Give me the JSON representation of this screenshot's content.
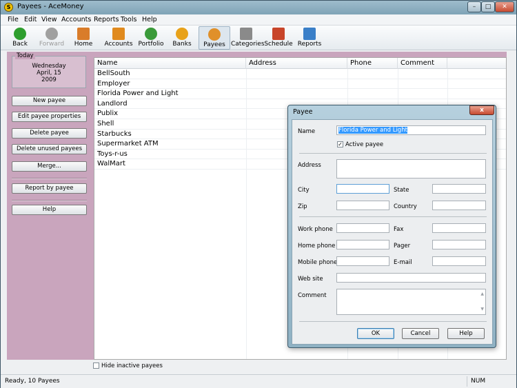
{
  "window": {
    "title": "Payees - AceMoney",
    "app_icon": "S"
  },
  "menu": [
    "File",
    "Edit",
    "View",
    "Accounts",
    "Reports",
    "Tools",
    "Help"
  ],
  "toolbar": [
    {
      "label": "Back",
      "icon": "back-arrow-icon",
      "color": "#2e9e2e"
    },
    {
      "label": "Forward",
      "icon": "forward-arrow-icon",
      "color": "#a0a0a0"
    },
    {
      "label": "Home",
      "icon": "home-icon",
      "color": "#d97c2a"
    },
    {
      "label": "Accounts",
      "icon": "accounts-icon",
      "color": "#e08a1e"
    },
    {
      "label": "Portfolio",
      "icon": "portfolio-icon",
      "color": "#3a9a3a"
    },
    {
      "label": "Banks",
      "icon": "banks-icon",
      "color": "#e8a21a"
    },
    {
      "label": "Payees",
      "icon": "payees-icon",
      "color": "#e0902a"
    },
    {
      "label": "Categories",
      "icon": "categories-icon",
      "color": "#8a8a8a"
    },
    {
      "label": "Schedule",
      "icon": "schedule-icon",
      "color": "#c8452a"
    },
    {
      "label": "Reports",
      "icon": "reports-icon",
      "color": "#3a7fc8"
    }
  ],
  "today": {
    "legend": "Today",
    "weekday": "Wednesday",
    "date": "April, 15",
    "year": "2009"
  },
  "left_buttons": {
    "new_payee": "New payee",
    "edit_payee": "Edit payee properties",
    "delete_payee": "Delete payee",
    "delete_unused": "Delete unused payees",
    "merge": "Merge...",
    "report_by_payee": "Report by payee",
    "help": "Help"
  },
  "grid": {
    "columns": [
      "Name",
      "Address",
      "Phone",
      "Comment"
    ],
    "rows": [
      "BellSouth",
      "Employer",
      "Florida Power and Light",
      "Landlord",
      "Publix",
      "Shell",
      "Starbucks",
      "Supermarket ATM",
      "Toys-r-us",
      "WalMart"
    ]
  },
  "hide_inactive_label": "Hide inactive payees",
  "status": {
    "text": "Ready, 10 Payees",
    "num": "NUM"
  },
  "dialog": {
    "title": "Payee",
    "close": "x",
    "name_label": "Name",
    "name_value": "Florida Power and Light",
    "active_label": "Active payee",
    "address_label": "Address",
    "city_label": "City",
    "state_label": "State",
    "zip_label": "Zip",
    "country_label": "Country",
    "work_phone_label": "Work phone",
    "fax_label": "Fax",
    "home_phone_label": "Home phone",
    "pager_label": "Pager",
    "mobile_phone_label": "Mobile phone",
    "email_label": "E-mail",
    "website_label": "Web site",
    "comment_label": "Comment",
    "ok": "OK",
    "cancel": "Cancel",
    "help": "Help"
  }
}
